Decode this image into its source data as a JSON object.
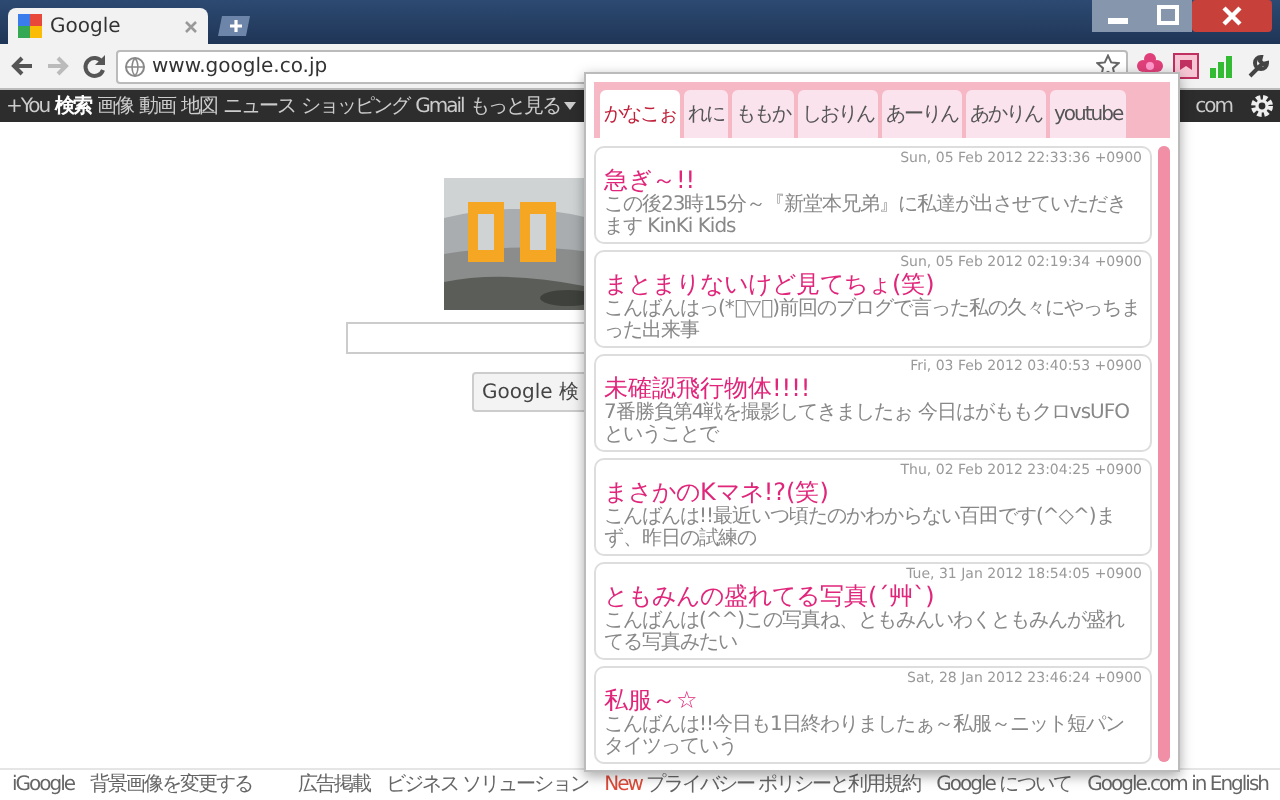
{
  "browser": {
    "tab_title": "Google",
    "address": "www.google.co.jp"
  },
  "google_bar": {
    "items": [
      {
        "label": "+You",
        "selected": false
      },
      {
        "label": "検索",
        "selected": true
      },
      {
        "label": "画像",
        "selected": false
      },
      {
        "label": "動画",
        "selected": false
      },
      {
        "label": "地図",
        "selected": false
      },
      {
        "label": "ニュース",
        "selected": false
      },
      {
        "label": "ショッピング",
        "selected": false
      },
      {
        "label": "Gmail",
        "selected": false
      }
    ],
    "more": "もっと見る",
    "account": "com"
  },
  "page": {
    "search_button": "Google 検"
  },
  "footer": {
    "left": [
      "iGoogle",
      "背景画像を変更する"
    ],
    "right": [
      {
        "label": "広告掲載"
      },
      {
        "label": "ビジネス ソリューション"
      },
      {
        "badge": "New",
        "label": "プライバシー ポリシーと利用規約"
      },
      {
        "label": "Google について"
      },
      {
        "label": "Google.com in English"
      }
    ]
  },
  "popup": {
    "tabs": [
      {
        "label": "かなこぉ",
        "selected": true
      },
      {
        "label": "れに",
        "selected": false
      },
      {
        "label": "ももか",
        "selected": false
      },
      {
        "label": "しおりん",
        "selected": false
      },
      {
        "label": "あーりん",
        "selected": false
      },
      {
        "label": "あかりん",
        "selected": false
      },
      {
        "label": "youtube",
        "selected": false
      }
    ],
    "posts": [
      {
        "date": "Sun, 05 Feb 2012 22:33:36 +0900",
        "title": "急ぎ～!!",
        "body": "この後23時15分～『新堂本兄弟』に私達が出させていただきます KinKi Kids"
      },
      {
        "date": "Sun, 05 Feb 2012 02:19:34 +0900",
        "title": "まとまりないけど見てちょ(笑)",
        "body": "こんばんはっ(*ﾟ▽ﾟ)前回のブログで言った私の久々にやっちまった出来事"
      },
      {
        "date": "Fri, 03 Feb 2012 03:40:53 +0900",
        "title": "未確認飛行物体!!!!",
        "body": "7番勝負第4戦を撮影してきましたぉ 今日はがももクロvsUFOということで"
      },
      {
        "date": "Thu, 02 Feb 2012 23:04:25 +0900",
        "title": "まさかのKマネ!?(笑)",
        "body": "こんばんは!!最近いつ頃たのかわからない百田です(^◇^)まず、昨日の試練の"
      },
      {
        "date": "Tue, 31 Jan 2012 18:54:05 +0900",
        "title": "ともみんの盛れてる写真(´艸`)",
        "body": "こんばんは(^^)この写真ね、ともみんいわくともみんが盛れてる写真みたい"
      },
      {
        "date": "Sat, 28 Jan 2012 23:46:24 +0900",
        "title": "私服～☆",
        "body": "こんばんは!!今日も1日終わりましたぁ～私服～ニット短パンタイツっていう"
      }
    ]
  }
}
